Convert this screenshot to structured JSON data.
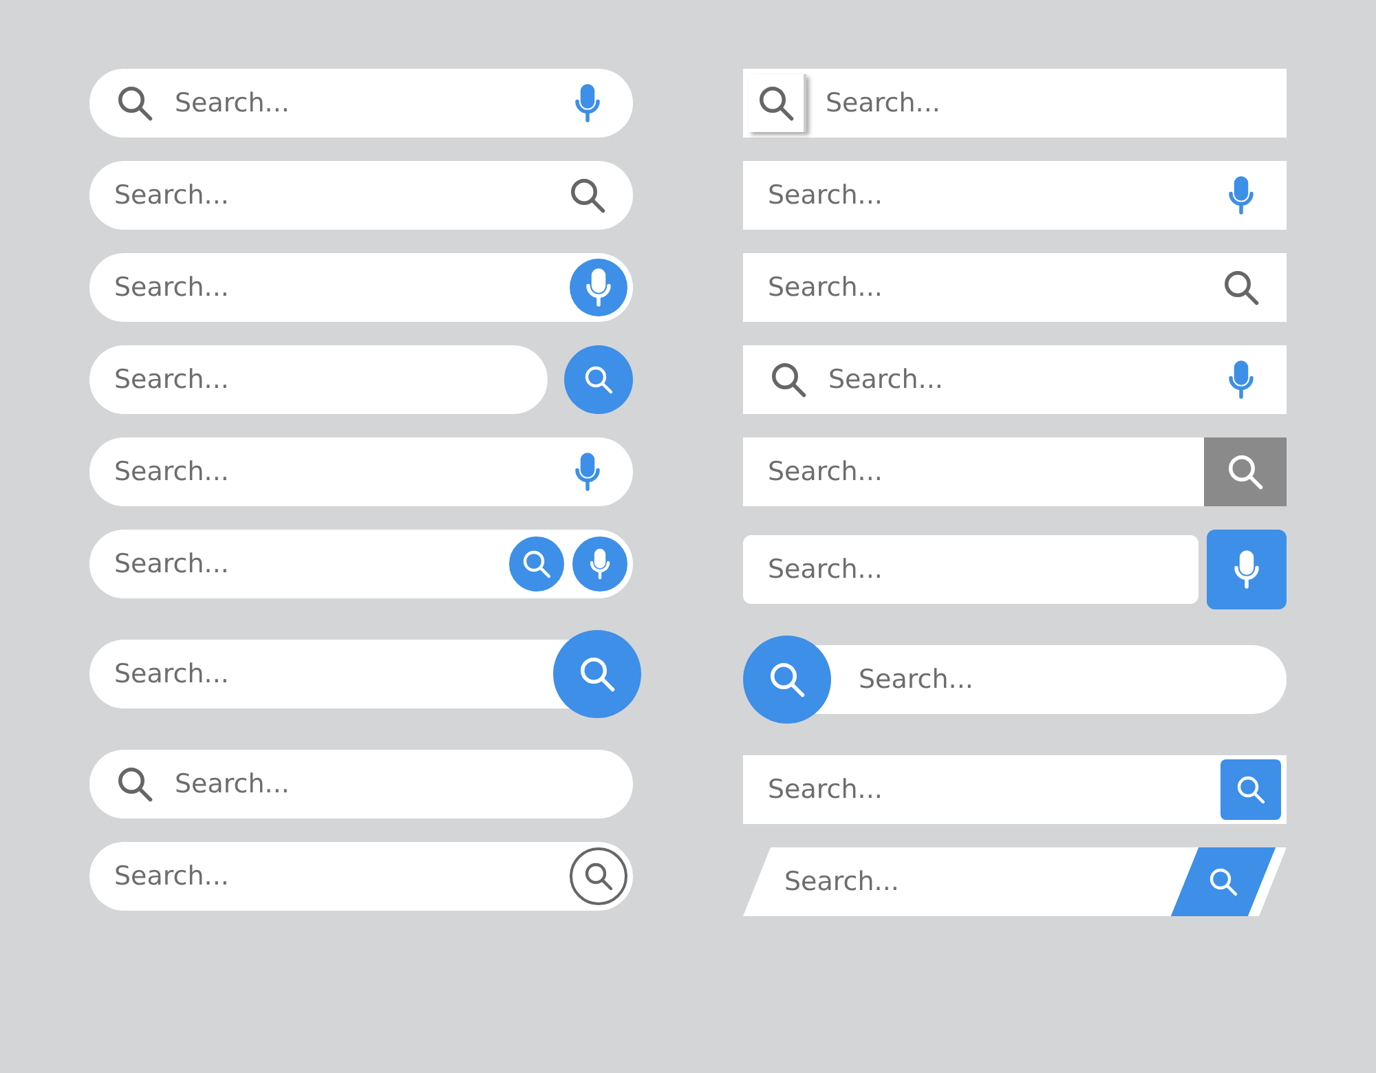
{
  "columns": [
    {
      "bars": [
        {
          "pill": true,
          "kind": "icon-left-mic",
          "placeholder": "Search..."
        },
        {
          "pill": true,
          "kind": "icon-right",
          "placeholder": "Search..."
        },
        {
          "pill": true,
          "kind": "mic-circle",
          "placeholder": "Search..."
        },
        {
          "pill": true,
          "kind": "detached-circle",
          "placeholder": "Search..."
        },
        {
          "pill": true,
          "kind": "mic-right",
          "placeholder": "Search..."
        },
        {
          "pill": true,
          "kind": "double-circle",
          "placeholder": "Search..."
        },
        {
          "pill": true,
          "kind": "big-circle",
          "placeholder": "Search..."
        },
        {
          "pill": true,
          "kind": "icon-left",
          "placeholder": "Search..."
        },
        {
          "pill": true,
          "kind": "ring-right",
          "placeholder": "Search..."
        }
      ]
    },
    {
      "bars": [
        {
          "pill": false,
          "kind": "boxed-icon-left",
          "placeholder": "Search..."
        },
        {
          "pill": false,
          "kind": "mic-right",
          "placeholder": "Search..."
        },
        {
          "pill": false,
          "kind": "icon-right",
          "placeholder": "Search..."
        },
        {
          "pill": false,
          "kind": "icon-left-mic",
          "placeholder": "Search..."
        },
        {
          "pill": false,
          "kind": "grey-button",
          "placeholder": "Search..."
        },
        {
          "pill": false,
          "kind": "detached-square-mic",
          "placeholder": "Search..."
        },
        {
          "pill": true,
          "kind": "big-circle-left",
          "placeholder": "Search..."
        },
        {
          "pill": false,
          "kind": "square-button",
          "placeholder": "Search..."
        },
        {
          "pill": false,
          "kind": "slanted",
          "placeholder": "Search..."
        }
      ]
    }
  ]
}
